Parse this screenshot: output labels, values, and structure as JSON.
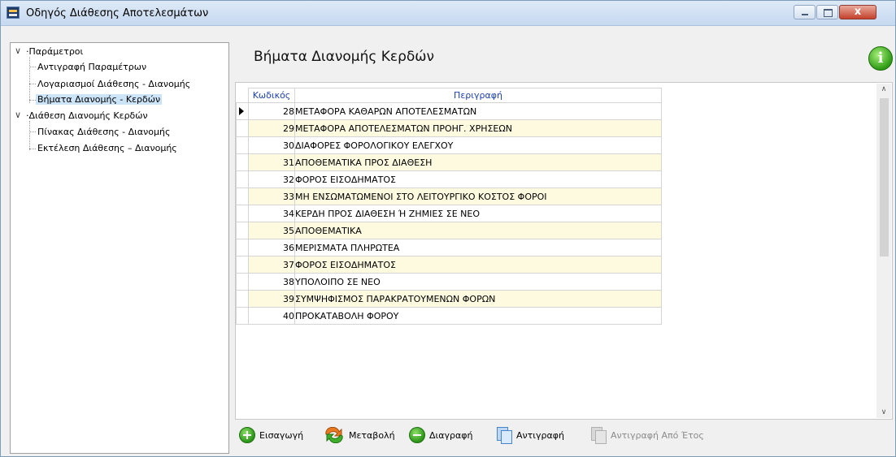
{
  "window": {
    "title": "Οδηγός Διάθεσης Αποτελεσμάτων",
    "close_glyph": "x"
  },
  "tree": {
    "groups": [
      {
        "label": "Παράμετροι",
        "items": [
          "Αντιγραφή Παραμέτρων",
          "Λογαριασμοί Διάθεσης - Διανομής",
          "Βήματα Διανομής - Κερδών"
        ]
      },
      {
        "label": "Διάθεση Διανομής Κερδών",
        "items": [
          "Πίνακας Διάθεσης - Διανομής",
          "Εκτέλεση Διάθεσης – Διανομής"
        ]
      }
    ],
    "selected": "Βήματα Διανομής - Κερδών"
  },
  "main": {
    "title": "Βήματα Διανομής Κερδών",
    "info_glyph": "i"
  },
  "grid": {
    "columns": {
      "code": "Κωδικός",
      "desc": "Περιγραφή"
    },
    "rows": [
      {
        "code": "28",
        "desc": "ΜΕΤΑΦΟΡΑ ΚΑΘΑΡΩΝ ΑΠΟΤΕΛΕΣΜΑΤΩΝ"
      },
      {
        "code": "29",
        "desc": "ΜΕΤΑΦΟΡΑ ΑΠΟΤΕΛΕΣΜΑΤΩΝ ΠΡΟΗΓ. ΧΡΗΣΕΩΝ"
      },
      {
        "code": "30",
        "desc": "ΔΙΑΦΟΡΕΣ ΦΟΡΟΛΟΓΙΚΟΥ ΕΛΕΓΧΟΥ"
      },
      {
        "code": "31",
        "desc": "ΑΠΟΘΕΜΑΤΙΚΑ ΠΡΟΣ ΔΙΑΘΕΣΗ"
      },
      {
        "code": "32",
        "desc": "ΦΟΡΟΣ ΕΙΣΟΔΗΜΑΤΟΣ"
      },
      {
        "code": "33",
        "desc": "ΜΗ ΕΝΣΩΜΑΤΩΜΕΝΟΙ ΣΤΟ ΛΕΙΤΟΥΡΓΙΚΟ ΚΟΣΤΟΣ ΦΟΡΟΙ"
      },
      {
        "code": "34",
        "desc": "ΚΕΡΔΗ ΠΡΟΣ ΔΙΑΘΕΣΗ Ή ΖΗΜΙΕΣ ΣΕ ΝΕΟ"
      },
      {
        "code": "35",
        "desc": "ΑΠΟΘΕΜΑΤΙΚΑ"
      },
      {
        "code": "36",
        "desc": "ΜΕΡΙΣΜΑΤΑ ΠΛΗΡΩΤΕΑ"
      },
      {
        "code": "37",
        "desc": "ΦΟΡΟΣ ΕΙΣΟΔΗΜΑΤΟΣ"
      },
      {
        "code": "38",
        "desc": "ΥΠΟΛΟΙΠΟ ΣΕ ΝΕΟ"
      },
      {
        "code": "39",
        "desc": "ΣΥΜΨΗΦΙΣΜΟΣ ΠΑΡΑΚΡΑΤΟΥΜΕΝΩΝ ΦΟΡΩΝ"
      },
      {
        "code": "40",
        "desc": "ΠΡΟΚΑΤΑΒΟΛΗ ΦΟΡΟΥ"
      }
    ],
    "current_row": 0
  },
  "toolbar": {
    "insert": "Εισαγωγή",
    "modify": "Μεταβολή",
    "delete": "Διαγραφή",
    "copy": "Αντιγραφή",
    "copy_from_year": "Αντιγραφή Από Έτος"
  },
  "colors": {
    "accent": "#1a3fb0",
    "alt_row": "#fdfae0",
    "selection": "#cce4f7"
  }
}
